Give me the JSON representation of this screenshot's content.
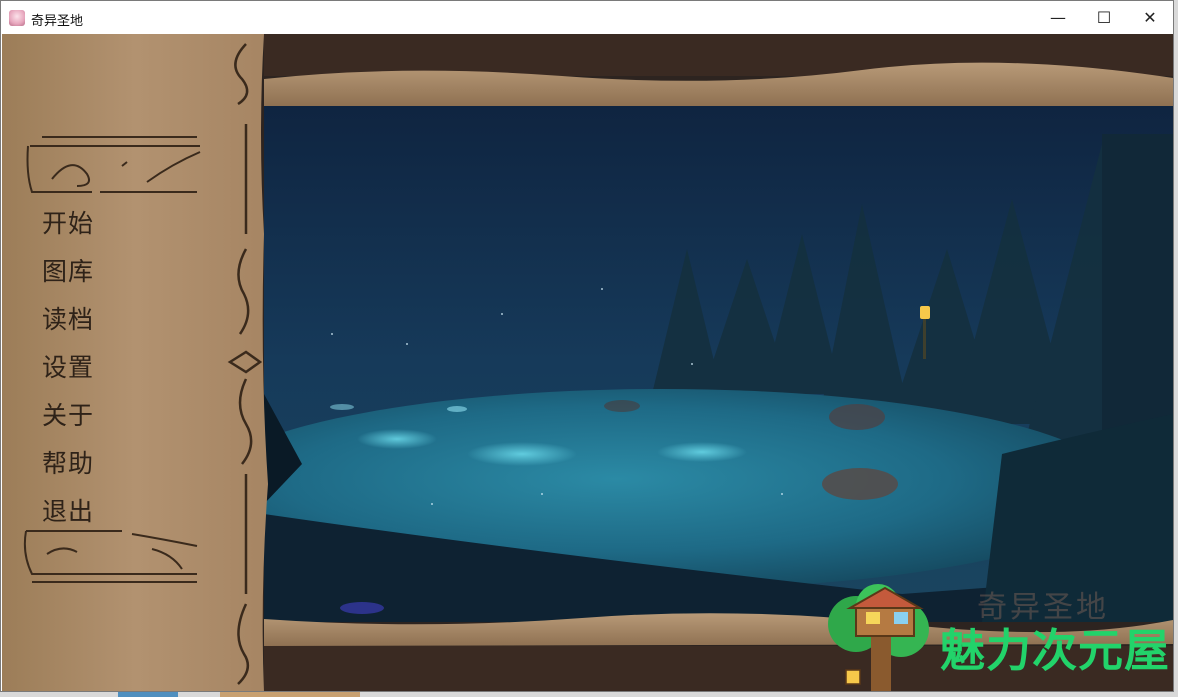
{
  "window": {
    "title": "奇异圣地",
    "controls": {
      "minimize": "—",
      "maximize": "☐",
      "close": "✕"
    }
  },
  "menu": {
    "items": [
      {
        "label": "开始"
      },
      {
        "label": "图库"
      },
      {
        "label": "读档"
      },
      {
        "label": "设置"
      },
      {
        "label": "关于"
      },
      {
        "label": "帮助"
      },
      {
        "label": "退出"
      }
    ]
  },
  "watermark": {
    "faded_text": "奇异圣地",
    "brand_text": "魅力次元屋"
  },
  "colors": {
    "parchment": "#a8875f",
    "frame_dark": "#2d2420",
    "lake_blue": "#1f6a86",
    "brand_green": "#22d36a"
  }
}
